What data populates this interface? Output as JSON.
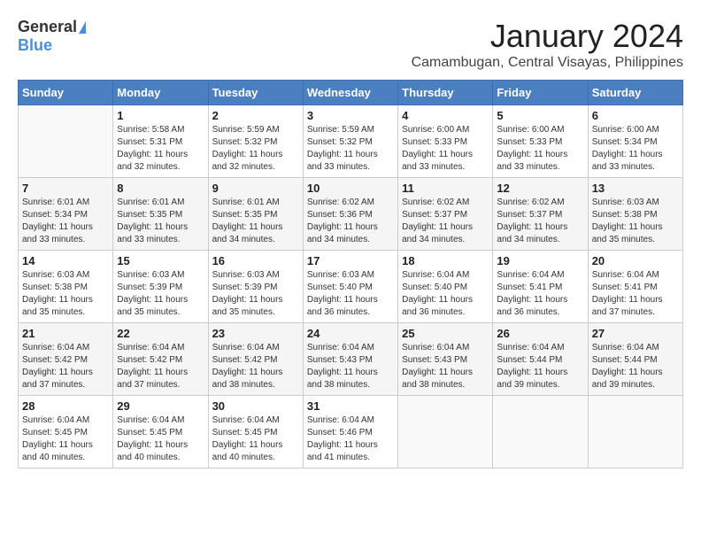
{
  "logo": {
    "general": "General",
    "blue": "Blue"
  },
  "title": "January 2024",
  "location": "Camambugan, Central Visayas, Philippines",
  "headers": [
    "Sunday",
    "Monday",
    "Tuesday",
    "Wednesday",
    "Thursday",
    "Friday",
    "Saturday"
  ],
  "weeks": [
    [
      {
        "day": "",
        "info": ""
      },
      {
        "day": "1",
        "info": "Sunrise: 5:58 AM\nSunset: 5:31 PM\nDaylight: 11 hours and 32 minutes."
      },
      {
        "day": "2",
        "info": "Sunrise: 5:59 AM\nSunset: 5:32 PM\nDaylight: 11 hours and 32 minutes."
      },
      {
        "day": "3",
        "info": "Sunrise: 5:59 AM\nSunset: 5:32 PM\nDaylight: 11 hours and 33 minutes."
      },
      {
        "day": "4",
        "info": "Sunrise: 6:00 AM\nSunset: 5:33 PM\nDaylight: 11 hours and 33 minutes."
      },
      {
        "day": "5",
        "info": "Sunrise: 6:00 AM\nSunset: 5:33 PM\nDaylight: 11 hours and 33 minutes."
      },
      {
        "day": "6",
        "info": "Sunrise: 6:00 AM\nSunset: 5:34 PM\nDaylight: 11 hours and 33 minutes."
      }
    ],
    [
      {
        "day": "7",
        "info": "Sunrise: 6:01 AM\nSunset: 5:34 PM\nDaylight: 11 hours and 33 minutes."
      },
      {
        "day": "8",
        "info": "Sunrise: 6:01 AM\nSunset: 5:35 PM\nDaylight: 11 hours and 33 minutes."
      },
      {
        "day": "9",
        "info": "Sunrise: 6:01 AM\nSunset: 5:35 PM\nDaylight: 11 hours and 34 minutes."
      },
      {
        "day": "10",
        "info": "Sunrise: 6:02 AM\nSunset: 5:36 PM\nDaylight: 11 hours and 34 minutes."
      },
      {
        "day": "11",
        "info": "Sunrise: 6:02 AM\nSunset: 5:37 PM\nDaylight: 11 hours and 34 minutes."
      },
      {
        "day": "12",
        "info": "Sunrise: 6:02 AM\nSunset: 5:37 PM\nDaylight: 11 hours and 34 minutes."
      },
      {
        "day": "13",
        "info": "Sunrise: 6:03 AM\nSunset: 5:38 PM\nDaylight: 11 hours and 35 minutes."
      }
    ],
    [
      {
        "day": "14",
        "info": "Sunrise: 6:03 AM\nSunset: 5:38 PM\nDaylight: 11 hours and 35 minutes."
      },
      {
        "day": "15",
        "info": "Sunrise: 6:03 AM\nSunset: 5:39 PM\nDaylight: 11 hours and 35 minutes."
      },
      {
        "day": "16",
        "info": "Sunrise: 6:03 AM\nSunset: 5:39 PM\nDaylight: 11 hours and 35 minutes."
      },
      {
        "day": "17",
        "info": "Sunrise: 6:03 AM\nSunset: 5:40 PM\nDaylight: 11 hours and 36 minutes."
      },
      {
        "day": "18",
        "info": "Sunrise: 6:04 AM\nSunset: 5:40 PM\nDaylight: 11 hours and 36 minutes."
      },
      {
        "day": "19",
        "info": "Sunrise: 6:04 AM\nSunset: 5:41 PM\nDaylight: 11 hours and 36 minutes."
      },
      {
        "day": "20",
        "info": "Sunrise: 6:04 AM\nSunset: 5:41 PM\nDaylight: 11 hours and 37 minutes."
      }
    ],
    [
      {
        "day": "21",
        "info": "Sunrise: 6:04 AM\nSunset: 5:42 PM\nDaylight: 11 hours and 37 minutes."
      },
      {
        "day": "22",
        "info": "Sunrise: 6:04 AM\nSunset: 5:42 PM\nDaylight: 11 hours and 37 minutes."
      },
      {
        "day": "23",
        "info": "Sunrise: 6:04 AM\nSunset: 5:42 PM\nDaylight: 11 hours and 38 minutes."
      },
      {
        "day": "24",
        "info": "Sunrise: 6:04 AM\nSunset: 5:43 PM\nDaylight: 11 hours and 38 minutes."
      },
      {
        "day": "25",
        "info": "Sunrise: 6:04 AM\nSunset: 5:43 PM\nDaylight: 11 hours and 38 minutes."
      },
      {
        "day": "26",
        "info": "Sunrise: 6:04 AM\nSunset: 5:44 PM\nDaylight: 11 hours and 39 minutes."
      },
      {
        "day": "27",
        "info": "Sunrise: 6:04 AM\nSunset: 5:44 PM\nDaylight: 11 hours and 39 minutes."
      }
    ],
    [
      {
        "day": "28",
        "info": "Sunrise: 6:04 AM\nSunset: 5:45 PM\nDaylight: 11 hours and 40 minutes."
      },
      {
        "day": "29",
        "info": "Sunrise: 6:04 AM\nSunset: 5:45 PM\nDaylight: 11 hours and 40 minutes."
      },
      {
        "day": "30",
        "info": "Sunrise: 6:04 AM\nSunset: 5:45 PM\nDaylight: 11 hours and 40 minutes."
      },
      {
        "day": "31",
        "info": "Sunrise: 6:04 AM\nSunset: 5:46 PM\nDaylight: 11 hours and 41 minutes."
      },
      {
        "day": "",
        "info": ""
      },
      {
        "day": "",
        "info": ""
      },
      {
        "day": "",
        "info": ""
      }
    ]
  ]
}
